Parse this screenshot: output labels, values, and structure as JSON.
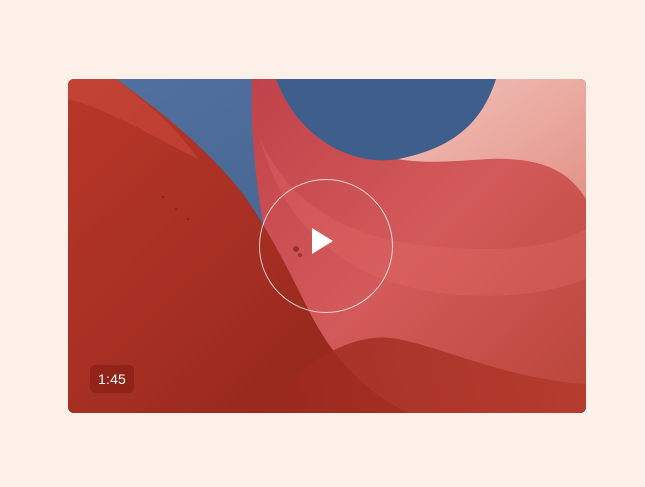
{
  "video": {
    "duration": "1:45",
    "thumbnail_subject": "abstract-red-sculpture",
    "colors": {
      "page_background": "#fcf0e8",
      "sky": "#3f5f8a",
      "sculpture_dark": "#9a2a1e",
      "sculpture_light": "#e0766c",
      "badge_background": "rgba(120,22,14,0.45)"
    }
  },
  "controls": {
    "play_icon": "play-icon"
  }
}
